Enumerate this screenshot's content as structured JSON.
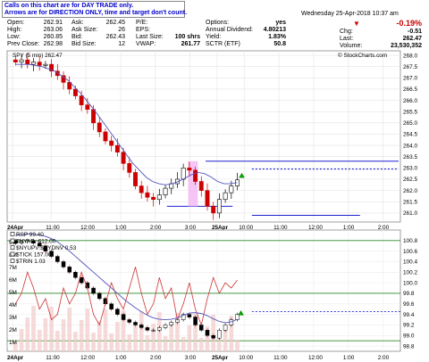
{
  "notice": {
    "line1": "Calls on this chart are for DAY TRADE only.",
    "line2": "Arrows are for DIRECTION ONLY, time and target don't count."
  },
  "header": {
    "datetime": "Wednesday 25-Apr-2018  10:37 am",
    "change_pct": "-0.19%",
    "chg_label": "Chg:",
    "chg_value": "-0.51",
    "last_label": "Last:",
    "last_value": "262.47",
    "volume_label": "Volume:",
    "volume_value": "23,530,352",
    "open_label": "Open:",
    "open_value": "262.91",
    "high_label": "High:",
    "high_value": "263.06",
    "low_label": "Low:",
    "low_value": "260.85",
    "prev_label": "Prev Close:",
    "prev_value": "262.98",
    "ask_label": "Ask:",
    "ask_value": "262.45",
    "asksize_label": "Ask Size:",
    "asksize_value": "26",
    "bid_label": "Bid:",
    "bid_value": "262.43",
    "bidsize_label": "Bid Size:",
    "bidsize_value": "12",
    "pe_label": "P/E:",
    "pe_value": "",
    "eps_label": "EPS:",
    "eps_value": "",
    "lastsize_label": "Last Size:",
    "lastsize_value": "100 shrs",
    "vwap_label": "VWAP:",
    "vwap_value": "261.77",
    "options_label": "Options:",
    "options_value": "yes",
    "dividend_label": "Annual Dividend:",
    "dividend_value": "4.80213",
    "yield_label": "Yield:",
    "yield_value": "1.83%",
    "sctr_label": "SCTR (ETF)",
    "sctr_value": "50.8"
  },
  "copyright": "© StockCharts.com",
  "colors": {
    "up": "#000000",
    "down": "#cc0000",
    "ma": "#5555bb",
    "line": "#0000cc",
    "green": "#2e8b2e",
    "pink": "#f3b6f3",
    "arrow": "#00aa00"
  },
  "chart_data": [
    {
      "type": "candlestick",
      "title": "SPY (5 min) 262.47",
      "ylim": [
        260.6,
        268.2
      ],
      "yticks": [
        261.0,
        261.5,
        262.0,
        262.5,
        263.0,
        263.5,
        264.0,
        264.5,
        265.0,
        265.5,
        266.0,
        266.5,
        267.0,
        267.5,
        268.0
      ],
      "ytick_labels": [
        "261.0",
        "261.5",
        "262.0",
        "262.5",
        "263.0",
        "263.5",
        "264.0",
        "264.5",
        "265.0",
        "265.5",
        "266.0",
        "266.5",
        "267.0",
        "267.5",
        "268.0"
      ],
      "xticks": [
        "24Apr",
        "11:00",
        "12:00",
        "1:00",
        "2:00",
        "3:00",
        "25Apr",
        "10:00",
        "11:00",
        "12:00",
        "1:00",
        "2:00",
        "3:00"
      ],
      "moving_average": [
        267.6,
        267.6,
        267.6,
        267.55,
        267.5,
        267.4,
        267.3,
        267.1,
        266.9,
        266.6,
        266.3,
        265.95,
        265.6,
        265.2,
        264.8,
        264.4,
        264.0,
        263.6,
        263.2,
        262.9,
        262.6,
        262.4,
        262.3,
        262.25,
        262.3,
        262.4,
        262.55,
        262.7,
        262.8,
        262.75,
        262.6,
        262.4,
        262.3,
        262.3,
        262.35
      ],
      "closes": [
        267.7,
        267.8,
        267.6,
        267.7,
        267.55,
        267.6,
        267.3,
        267.1,
        266.8,
        266.5,
        266.2,
        265.8,
        265.6,
        265.0,
        264.6,
        264.2,
        264.0,
        263.7,
        263.2,
        262.8,
        262.2,
        261.9,
        261.7,
        261.6,
        261.8,
        262.1,
        262.3,
        262.5,
        263.0,
        262.9,
        262.4,
        262.0,
        261.3,
        261.0,
        261.6,
        261.9,
        262.2,
        262.47
      ],
      "levels": [
        {
          "value": 263.3,
          "style": "solid",
          "x_range": [
            0.5,
            1.0
          ]
        },
        {
          "value": 262.95,
          "style": "dashed",
          "x_range": [
            0.62,
            1.0
          ]
        },
        {
          "value": 261.3,
          "style": "solid",
          "x_range": [
            0.4,
            0.57
          ]
        },
        {
          "value": 260.9,
          "style": "solid",
          "x_range": [
            0.62,
            0.9
          ]
        }
      ]
    },
    {
      "type": "line",
      "legend": [
        "RSP 99.40",
        "$NYAD -612.00",
        "$NYUPV:$NYDNV 0.53",
        "$TICK 157.00",
        "$TRIN 1.03"
      ],
      "ylim_right": [
        98.7,
        101.0
      ],
      "yticks_right": [
        98.8,
        99.0,
        99.2,
        99.4,
        99.6,
        99.8,
        100.0,
        100.2,
        100.4,
        100.6,
        100.8
      ],
      "ytick_labels_right": [
        "98.8",
        "99.0",
        "99.2",
        "99.4",
        "99.6",
        "99.8",
        "100.0",
        "100.2",
        "100.4",
        "100.6",
        "100.8"
      ],
      "yticks_left": [
        "1M",
        "2M",
        "3M",
        "4M",
        "5M",
        "6M",
        "7M",
        "8M",
        "9M"
      ],
      "xticks": [
        "24Apr",
        "11:00",
        "12:00",
        "1:00",
        "2:00",
        "3:00",
        "25Apr",
        "10:00",
        "11:00",
        "12:00",
        "1:00",
        "2:00",
        "3:00"
      ],
      "rsp_closes": [
        100.75,
        100.78,
        100.8,
        100.75,
        100.7,
        100.6,
        100.5,
        100.4,
        100.3,
        100.2,
        100.1,
        100.0,
        99.9,
        99.8,
        99.7,
        99.6,
        99.5,
        99.4,
        99.3,
        99.25,
        99.2,
        99.15,
        99.1,
        99.1,
        99.15,
        99.2,
        99.25,
        99.3,
        99.4,
        99.35,
        99.2,
        99.1,
        99.0,
        98.95,
        99.1,
        99.2,
        99.3,
        99.4
      ],
      "indicator_line": [
        99.6,
        99.8,
        100.2,
        99.9,
        99.5,
        99.7,
        99.3,
        99.4,
        99.9,
        99.6,
        99.8,
        100.2,
        99.9,
        99.4,
        99.2,
        99.6,
        100.0,
        99.7,
        99.5,
        99.9,
        100.3,
        99.8,
        99.4,
        99.6,
        100.1,
        99.7,
        99.9,
        99.3,
        99.6,
        100.0,
        99.5,
        99.2,
        99.7,
        100.1,
        99.8,
        100.0,
        99.9,
        100.05
      ],
      "green_levels": [
        100.8,
        99.8,
        98.9
      ],
      "dashed_level": 99.45
    }
  ]
}
